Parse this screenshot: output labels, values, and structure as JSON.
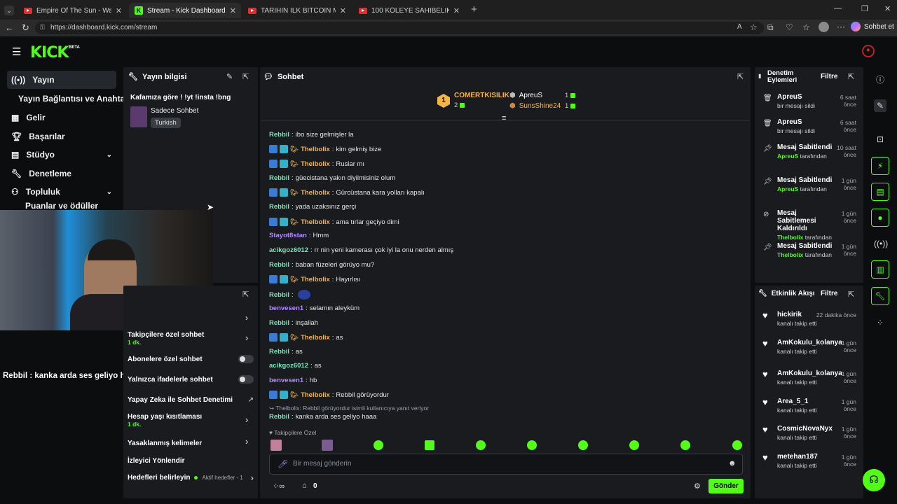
{
  "browser": {
    "tabs": [
      {
        "title": "Empire Of The Sun - Walking On A"
      },
      {
        "title": "Stream - Kick Dashboard"
      },
      {
        "title": "TARİHİN İLK BITCOIN MİLYARDERİ"
      },
      {
        "title": "100 KÖLEYE SAHİBELİK YAPTIM! (S"
      }
    ],
    "url": "https://dashboard.kick.com/stream",
    "copilot": "Sohbet et"
  },
  "app": {
    "logo": "KICK",
    "beta": "BETA",
    "accent": "#53fc18"
  },
  "sidebar": {
    "items": [
      {
        "label": "Yayın",
        "icon": "broadcast-icon"
      },
      {
        "label": "Yayın Bağlantısı ve Anahtarı"
      },
      {
        "label": "Gelir",
        "icon": "chart-icon"
      },
      {
        "label": "Başarılar",
        "icon": "trophy-icon"
      },
      {
        "label": "Stüdyo",
        "icon": "studio-icon"
      },
      {
        "label": "Denetleme",
        "icon": "wrench-icon"
      },
      {
        "label": "Topluluk",
        "icon": "people-icon"
      },
      {
        "label": "Puanlar ve ödüller"
      }
    ]
  },
  "stream_info": {
    "header": "Yayın bilgisi",
    "title": "Kafamıza göre ! !yt !insta !bng",
    "category": "Sadece Sohbet",
    "tag": "Turkish"
  },
  "overlay_chat": "Rebbil : kanka arda ses geliyo haaa",
  "chat_settings": {
    "items": [
      {
        "label": "Takipçilere özel sohbet",
        "sub": "1 dk."
      },
      {
        "label": "Abonelere özel sohbet"
      },
      {
        "label": "Yalnızca ifadelerle sohbet"
      },
      {
        "label": "Yapay Zeka ile Sohbet Denetimi"
      },
      {
        "label": "Hesap yaşı kısıtlaması",
        "sub": "1 dk."
      },
      {
        "label": "Yasaklanmış kelimeler"
      },
      {
        "label": "İzleyici Yönlendir"
      },
      {
        "label": "Hedefleri belirleyin",
        "sub": "Aktif hedefler - 1"
      }
    ]
  },
  "chat": {
    "header": "Sohbet",
    "leaderboard": {
      "first": {
        "name": "COMERTKISILIK",
        "count": "2",
        "rank": "1"
      },
      "second": {
        "name": "ApreuS",
        "count": "1"
      },
      "third": {
        "name": "SunsShine24",
        "count": "1"
      }
    },
    "messages": [
      {
        "user": "Rebbil",
        "text": "ibo size gelmişler la",
        "color": "g",
        "badges": false
      },
      {
        "user": "Thelbolix",
        "text": "kim gelmiş bize",
        "color": "o",
        "badges": true
      },
      {
        "user": "Thelbolix",
        "text": "Ruslar mı",
        "color": "o",
        "badges": true
      },
      {
        "user": "Rebbil",
        "text": "güecistana yakın diyilmisiniz olum",
        "color": "g",
        "badges": false
      },
      {
        "user": "Thelbolix",
        "text": "Gürcüstana kara yolları kapalı",
        "color": "o",
        "badges": true
      },
      {
        "user": "Rebbil",
        "text": "yada uzaksınız gerçi",
        "color": "g",
        "badges": false
      },
      {
        "user": "Thelbolix",
        "text": "ama tırlar geçiyo dimi",
        "color": "o",
        "badges": true
      },
      {
        "user": "Stayot8stan",
        "text": "Hmm",
        "color": "p",
        "badges": false
      },
      {
        "user": "acikgoz6012",
        "text": "rr nin yeni kamerası çok iyi la onu nerden almış",
        "color": "g",
        "badges": false
      },
      {
        "user": "Rebbil",
        "text": "baban füzeleri görüyo mu?",
        "color": "g",
        "badges": false
      },
      {
        "user": "Thelbolix",
        "text": "Hayırlısı",
        "color": "o",
        "badges": true
      },
      {
        "user": "Rebbil",
        "text": "",
        "color": "g",
        "badges": false
      },
      {
        "user": "benvesen1",
        "text": "selamın aleyküm",
        "color": "p",
        "badges": false
      },
      {
        "user": "Rebbil",
        "text": "inşallah",
        "color": "g",
        "badges": false
      },
      {
        "user": "Thelbolix",
        "text": "as",
        "color": "o",
        "badges": true
      },
      {
        "user": "Rebbil",
        "text": "as",
        "color": "g",
        "badges": false
      },
      {
        "user": "acikgoz6012",
        "text": "as",
        "color": "g",
        "badges": false
      },
      {
        "user": "benvesen1",
        "text": "hb",
        "color": "p",
        "badges": false
      },
      {
        "user": "Thelbolix",
        "text": "Rebbil görüyordur",
        "color": "o",
        "badges": true
      }
    ],
    "reply_note": "Thelbolix: Rebbil görüyordur isimli kullanıcıya yanıt veriyor",
    "last": {
      "user": "Rebbil",
      "text": "kanka arda ses geliyo haaa"
    },
    "mode": "Takipçilere Özel",
    "placeholder": "Bir mesaj gönderin",
    "points": "0",
    "send": "Gönder"
  },
  "moderation": {
    "header": "Denetim Eylemleri",
    "filter": "Filtre",
    "items": [
      {
        "title": "ApreuS",
        "sub": "bir mesajı sildi",
        "time": "6 saat önce",
        "icon": "trash-icon"
      },
      {
        "title": "ApreuS",
        "sub": "bir mesajı sildi",
        "time": "6 saat önce",
        "icon": "trash-icon"
      },
      {
        "title": "Mesaj Sabitlendi",
        "who": "ApreuS",
        "by": "tarafından",
        "time": "10 saat önce",
        "icon": "pin-icon"
      },
      {
        "title": "Mesaj Sabitlendi",
        "who": "ApreuS",
        "by": "tarafından",
        "time": "1 gün önce",
        "icon": "pin-icon"
      },
      {
        "title": "Mesaj Sabitlemesi Kaldırıldı",
        "who": "Thelbolix",
        "by": "tarafından",
        "time": "1 gün önce",
        "icon": "unpin-icon"
      },
      {
        "title": "Mesaj Sabitlendi",
        "who": "Thelbolix",
        "by": "tarafından",
        "time": "1 gün önce",
        "icon": "pin-icon"
      }
    ]
  },
  "activity": {
    "header": "Etkinlik Akışı",
    "filter": "Filtre",
    "items": [
      {
        "user": "hickirik",
        "sub": "kanalı takip etti",
        "time": "22 dakika önce"
      },
      {
        "user": "AmKokulu_kolanya",
        "sub": "kanalı takip etti",
        "time": "1 gün önce"
      },
      {
        "user": "AmKokulu_kolanya",
        "sub": "kanalı takip etti",
        "time": "1 gün önce"
      },
      {
        "user": "Area_5_1",
        "sub": "kanalı takip etti",
        "time": "1 gün önce"
      },
      {
        "user": "CosmicNovaNyx",
        "sub": "kanalı takip etti",
        "time": "1 gün önce"
      },
      {
        "user": "metehan187",
        "sub": "kanalı takip etti",
        "time": "1 gün önce"
      }
    ]
  }
}
